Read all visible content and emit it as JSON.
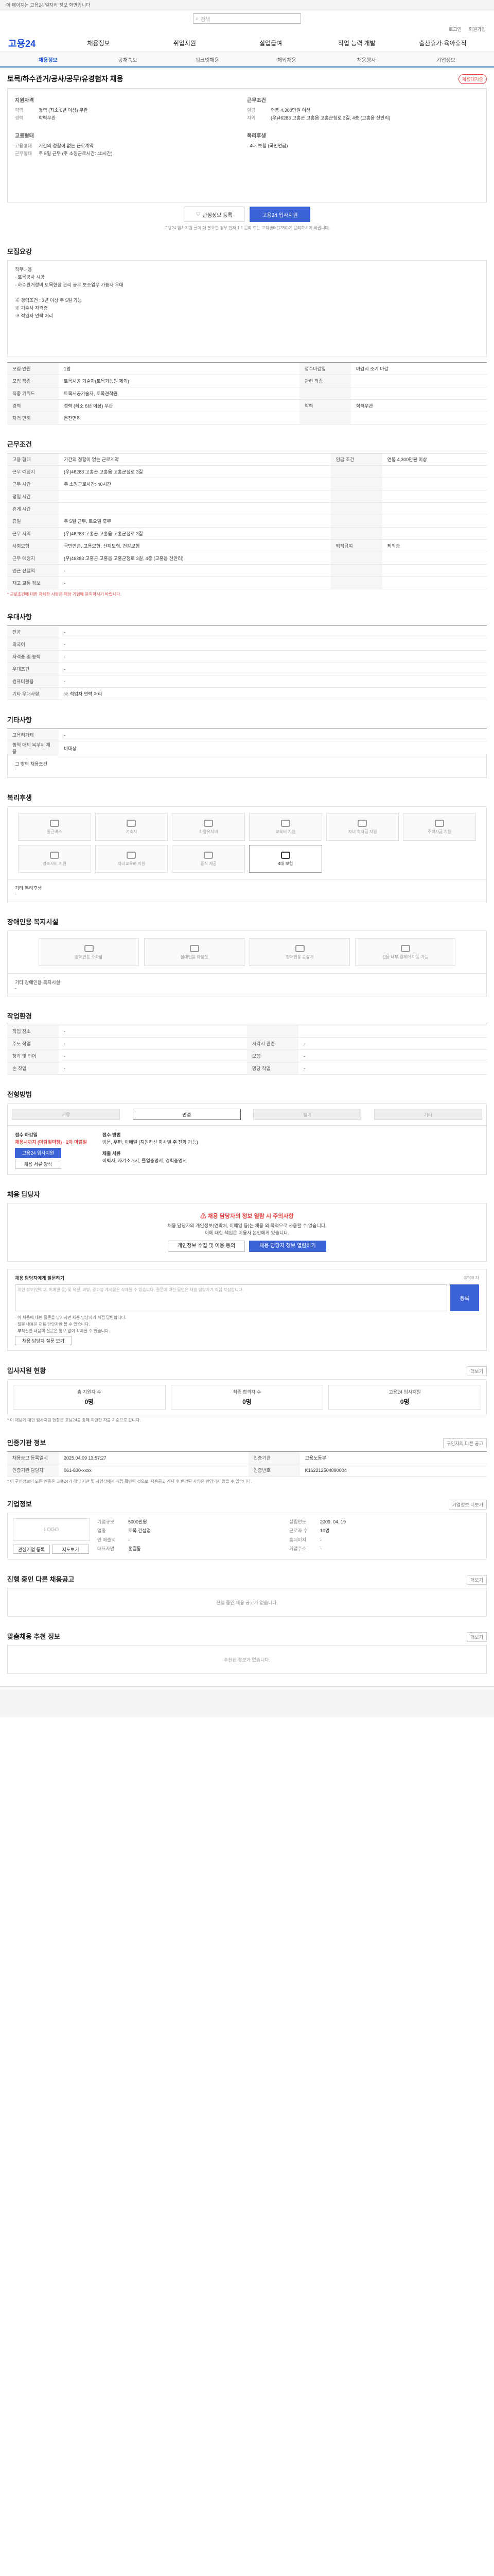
{
  "topbar": {
    "text": "이 페이지는 고용24 일자리 정보 화면입니다"
  },
  "search": {
    "placeholder": "검색",
    "icon": "search-icon"
  },
  "util": {
    "login": "로그인",
    "join": "회원가입"
  },
  "gnb": {
    "logo": "고용24",
    "items": [
      "채용정보",
      "취업지원",
      "실업급여",
      "직업 능력 개발",
      "출산휴가·육아휴직"
    ]
  },
  "subnav": {
    "items": [
      "채용정보",
      "공채속보",
      "워크넷채용",
      "해외채용",
      "채용행사",
      "기업정보"
    ]
  },
  "job": {
    "title": "토목/하수관거/공사/공무/유경험자 채용",
    "badge": "채용대기중",
    "recruit_head": "지원자격",
    "edu_label": "학력",
    "edu_value": "경력 (최소 6년 이상) 무관",
    "career_label": "경력",
    "career_value": "학력무관",
    "employ_head": "고용형태",
    "emp_label": "고용형태",
    "emp_value": "기간의 정함이 없는 근로계약",
    "emp2_label": "근무형태",
    "emp2_value": "주 5일 근무 (주 소정근로시간: 40시간)",
    "cond_head": "근무조건",
    "wage_label": "임금",
    "wage_value": "연봉 4,300만원 이상",
    "loc_label": "지역",
    "loc_value": "(우)46283 고홍군 고홍읍 고홍군청로 3길, 4층 (고홍읍 신안리)",
    "benefit_head": "복리후생",
    "benefit_value": "· 4대 보험 (국민연금)"
  },
  "actions": {
    "bookmark": "관심정보 등록",
    "apply": "고용24 입사지원"
  },
  "actions_note": "고용24 입사지원 글이 더 필요한 경우 먼저 1:1 문의 또는 고객센터(1350)에 문의하시기 바랍니다.",
  "sec_recruit": {
    "title": "모집요강",
    "desc": "직무내용\n· 토목공사 시공\n· 하수관거정비 토목현장 관리 공무 보조업무 가능자 우대\n\n※ 경력조건 : 3년 이상 주 5일 가능\n※ 기술사 자격증\n※ 적임자 연락 처리",
    "rows": [
      [
        "모집 인원",
        "1명",
        "접수마감일",
        "마감시 조기 마감"
      ],
      [
        "모집 직종",
        "토목시공 기술자(토목기능원 제외)",
        "관련 직종",
        ""
      ],
      [
        "직종 키워드",
        "토목시공기술자, 토목견적원",
        "",
        ""
      ],
      [
        "경력",
        "경력 (최소 6년 이상) 무관",
        "학력",
        "학력무관"
      ],
      [
        "자격 면허",
        "운전면허",
        "",
        ""
      ]
    ]
  },
  "sec_cond": {
    "title": "근무조건",
    "rows": [
      [
        "고용 형태",
        "기간의 정함이 없는 근로계약",
        "임금 조건",
        "연봉 4,300만원 이상"
      ],
      [
        "근무 예정지",
        "(우)46283 고홍군 고홍읍 고홍군청로 3길",
        "",
        ""
      ],
      [
        "근무 시간",
        "주 소정근로시간: 40시간",
        "",
        ""
      ],
      [
        "평일 시간",
        "",
        "",
        ""
      ],
      [
        "휴게 시간",
        "",
        "",
        ""
      ],
      [
        "휴일",
        "주 5일 근무, 토요일 휴무",
        "",
        ""
      ],
      [
        "근무 지역",
        "(우)46283 고홍군 고홍읍 고홍군청로 3길",
        "",
        ""
      ],
      [
        "사회보험",
        "국민연금, 고용보험, 산재보험, 건강보험",
        "퇴직급여",
        "퇴직금"
      ],
      [
        "근무 예정지",
        "(우)46283 고홍군 고홍읍 고홍군청로 3길, 4층 (고홍읍 신안리)",
        "",
        ""
      ],
      [
        "인근 전철역",
        "-",
        "",
        ""
      ],
      [
        "재고 교통 정보",
        "-",
        "",
        ""
      ]
    ],
    "note": "* 근로조건에 대한 자세한 사항은 해당 기업에 문의하시기 바랍니다."
  },
  "sec_pref": {
    "title": "우대사항",
    "rows": [
      [
        "전공",
        "-"
      ],
      [
        "외국어",
        "-"
      ],
      [
        "자격증 및 능력",
        "-"
      ],
      [
        "우대조건",
        "-"
      ],
      [
        "컴퓨터활용",
        "-"
      ],
      [
        "기타 우대사항",
        "※ 적임자 연락 처리"
      ]
    ]
  },
  "sec_etc": {
    "title": "기타사항",
    "rows": [
      [
        "고용허가제",
        "-"
      ],
      [
        "병역 대체 복무지 채용",
        "비대상"
      ]
    ],
    "extra": "그 밖의 채용조건\n-"
  },
  "sec_welfare": {
    "title": "복리후생",
    "items": [
      "통근버스",
      "기숙사",
      "차량유지비",
      "교육비 지원",
      "자녀 학자금 지원",
      "주택자금 지원",
      "경조사비 지원",
      "자녀교육비 지원",
      "중식 제공",
      "4대 보험"
    ],
    "active": 9,
    "etc_label": "기타 복리후생",
    "etc_value": "-"
  },
  "sec_disabled": {
    "title": "장애인용 복지시설",
    "items": [
      "장애인용 주차장",
      "장애인용 화장실",
      "장애인용 승강기",
      "건물 내부 휠체어 이동 가능"
    ],
    "etc_label": "기타 장애인용 복지시설",
    "etc_value": "-"
  },
  "sec_work": {
    "title": "작업환경",
    "rows": [
      [
        "작업 장소",
        "-",
        "",
        ""
      ],
      [
        "주도 작업",
        "-",
        "시각시 관련",
        "-"
      ],
      [
        "청각 및 언어",
        "-",
        "보행",
        "-"
      ],
      [
        "손 작업",
        "-",
        "명당 작업",
        "-"
      ]
    ]
  },
  "sec_process": {
    "title": "전형방법",
    "steps": [
      "서류",
      "면접",
      "필기",
      "기타"
    ],
    "active": 1,
    "deadline_head": "접수 마감일",
    "deadline_value": "채용시까지 (마감일미정) · 2차 마감일",
    "apply_btn": "고용24 입사지원",
    "extra_btn": "채용 서류 양식",
    "method_head": "접수 방법",
    "method_value": "방문, 우편, 이메일 (지원하신 회사별 주 전화 가능)",
    "docs_head": "제출 서류",
    "docs_value": "이력서, 자기소개서, 졸업증명서, 경력증명서"
  },
  "sec_manager": {
    "title": "채용 담당자",
    "alert": "채용 담당자의 정보 열람 시 주의사항",
    "line1": "채용 담당자의 개인정보(연락처, 이메일 등)는 채용 외 목적으로 사용할 수 없습니다.",
    "line2": "이에 대한 책임은 이용자 본인에게 있습니다.",
    "btn1": "개인정보 수집 및 이용 동의",
    "btn2": "채용 담당자 정보 열람하기"
  },
  "sec_qa": {
    "title": "채용 담당자에게 질문하기",
    "counter": "0/500 자",
    "placeholder": "개인 정보(연락처, 이메일 등) 및 욕설, 비방, 광고성 게시물은 삭제될 수 있습니다. 질문에 대한 답변은 채용 담당자가 직접 작성합니다.",
    "submit": "등록",
    "notes": "· 이 채용에 대한 질문을 남기시면 채용 담당자가 직접 답변합니다.\n· 질문 내용은 채용 담당자만 볼 수 있습니다.\n· 부적절한 내용의 질문은 통보 없이 삭제될 수 있습니다.",
    "more": "채용 담당자 질문 보기"
  },
  "sec_stats": {
    "title": "입사지원 현황",
    "more": "더보기",
    "items": [
      [
        "총 지원자 수",
        "0명"
      ],
      [
        "최종 합격자 수",
        "0명"
      ],
      [
        "고용24 입사지원",
        "0명"
      ]
    ],
    "note": "* 이 채용에 대한 입사지원 현황은 고용24를 통해 지원한 자를 기준으로 합니다."
  },
  "sec_info": {
    "title": "인증기관 정보",
    "more": "구인자의 다른 공고",
    "rows": [
      [
        "채용공고 등록일시",
        "2025.04.09 13:57:27",
        "인증기관",
        "고용노동부"
      ],
      [
        "인증기관 담당자",
        "061-830-xxxx",
        "인증번호",
        "K162212504090004"
      ]
    ],
    "note": "* 이 구인정보의 모든 인증은 고용24가 해당 기관 및 사업장에서 직접 확인한 것으로, 채용공고 게재 후 변경된 사항은 반영되지 않을 수 있습니다."
  },
  "sec_corp": {
    "title": "기업정보",
    "more": "기업정보 더보기",
    "logo": "LOGO",
    "kv": [
      [
        "기업규모",
        "5000만원",
        "설립연도",
        "2009. 04. 19"
      ],
      [
        "업종",
        "토목 건설업",
        "근로자 수",
        "10명"
      ],
      [
        "연 매출액",
        "-",
        "홈페이지",
        "-"
      ],
      [
        "대표자명",
        "홍길동",
        "기업주소",
        "-"
      ]
    ],
    "btn_bookmark": "관심기업 등록",
    "btn_map": "지도보기"
  },
  "sec_other": {
    "title": "진행 중인 다른 채용공고",
    "more": "더보기",
    "empty": "진행 중인 채용 공고가 없습니다."
  },
  "sec_recommend": {
    "title": "맞춤채용 추천 정보",
    "more": "더보기",
    "empty": "추천된 정보가 없습니다."
  }
}
